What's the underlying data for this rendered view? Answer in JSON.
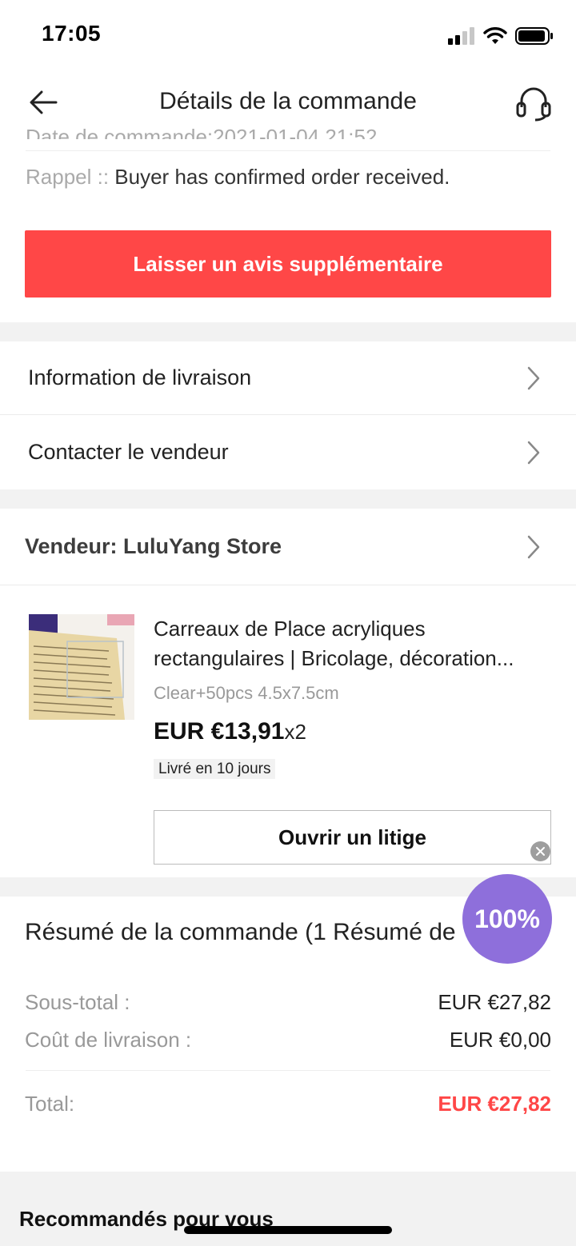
{
  "status_bar": {
    "time": "17:05"
  },
  "header": {
    "title": "Détails de la commande"
  },
  "order_info": {
    "date_line": "Date de commande:2021-01-04 21:52",
    "reminder_label": "Rappel :: ",
    "reminder_text": "Buyer has confirmed order received."
  },
  "review_button": {
    "label": "Laisser un avis supplémentaire",
    "color": "#ff4747"
  },
  "menu": [
    {
      "label": "Information de livraison"
    },
    {
      "label": "Contacter le vendeur"
    }
  ],
  "seller": {
    "label": "Vendeur: LuluYang Store"
  },
  "product": {
    "title_line1": "Carreaux de Place acryliques",
    "title_line2": "rectangulaires | Bricolage, décoration...",
    "variant": "Clear+50pcs 4.5x7.5cm",
    "price": "EUR €13,91",
    "quantity": "x2",
    "delivery": "Livré en 10 jours"
  },
  "dispute_button": {
    "label": "Ouvrir un litige"
  },
  "progress_badge": {
    "value": "100%",
    "color": "#8e6fdb"
  },
  "summary": {
    "title": "Résumé de la commande (1 Résumé de",
    "subtotal_label": "Sous-total :",
    "subtotal_value": "EUR €27,82",
    "shipping_label": "Coût de livraison :",
    "shipping_value": "EUR €0,00",
    "total_label": "Total:",
    "total_value": "EUR €27,82"
  },
  "recommendations": {
    "title": "Recommandés pour vous"
  }
}
